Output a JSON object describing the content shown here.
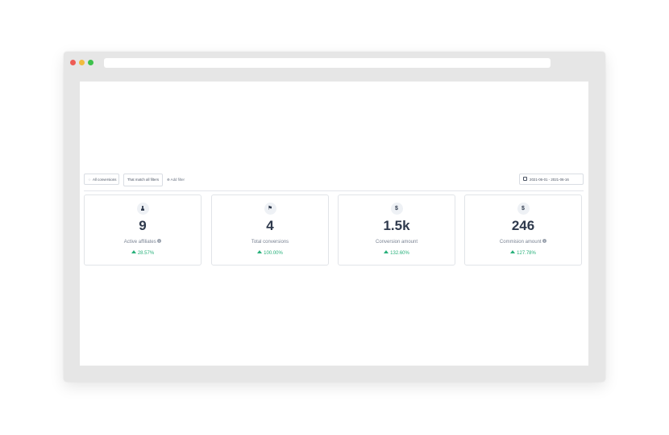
{
  "filters": {
    "all_conversions": "All conversions",
    "match_all": "That match all filters",
    "add_filter": "Add filter",
    "date_range": "2021-06-01 - 2021-06-16"
  },
  "stats": [
    {
      "icon": "user-icon",
      "value": "9",
      "label": "Active affiliates",
      "has_info": true,
      "change": "28.57%"
    },
    {
      "icon": "flag-icon",
      "value": "4",
      "label": "Total conversions",
      "has_info": false,
      "change": "100.00%"
    },
    {
      "icon": "dollar-icon",
      "value": "1.5k",
      "label": "Conversion amount",
      "has_info": false,
      "change": "132.60%"
    },
    {
      "icon": "dollar-icon",
      "value": "246",
      "label": "Commision amount",
      "has_info": true,
      "change": "127.78%"
    }
  ],
  "colors": {
    "positive": "#27b07a",
    "text_dark": "#2f3a4d"
  }
}
